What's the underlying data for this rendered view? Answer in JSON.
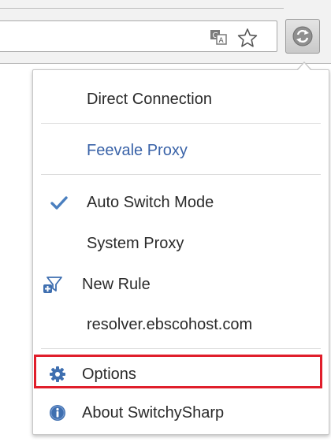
{
  "menu": {
    "direct_connection": "Direct Connection",
    "proxy_profile": "Feevale Proxy",
    "auto_switch_mode": "Auto Switch Mode",
    "system_proxy": "System Proxy",
    "new_rule": "New Rule",
    "rule_host": "resolver.ebscohost.com",
    "options": "Options",
    "about": "About SwitchySharp"
  },
  "state": {
    "selected_mode": "Auto Switch Mode",
    "highlighted_item": "Options"
  },
  "icons": {
    "translate": "translate-icon",
    "bookmark_star": "bookmark-star-icon",
    "extension": "switchysharp-extension-icon",
    "checkmark": "checkmark-icon",
    "new_rule": "filter-add-icon",
    "options": "gear-icon",
    "about": "info-icon"
  },
  "colors": {
    "proxy_link": "#3a63a8",
    "checkmark": "#4a7fbf",
    "highlight_border": "#e01e2b"
  }
}
